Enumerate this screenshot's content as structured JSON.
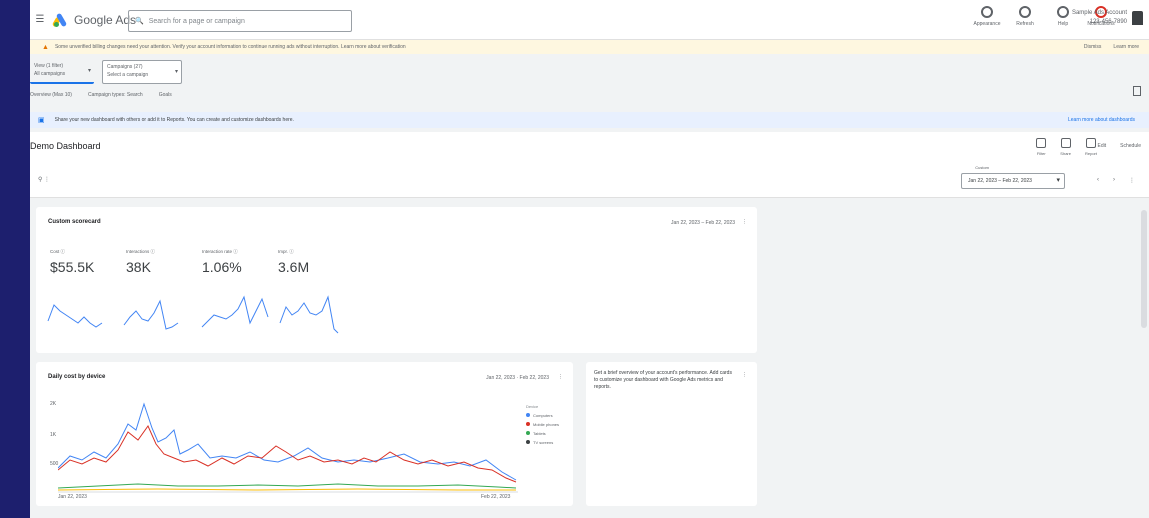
{
  "app": {
    "menu_icon": "menu-icon",
    "logo_text": "Google Ads",
    "logo_colors": [
      "#fbbc04",
      "#4285f4",
      "#34a853"
    ]
  },
  "search": {
    "placeholder": "Search for a page or campaign"
  },
  "top_actions": [
    {
      "name": "appearance-icon",
      "label": "Appearance"
    },
    {
      "name": "refresh-icon",
      "label": "Refresh"
    },
    {
      "name": "help-icon",
      "label": "Help"
    },
    {
      "name": "notifications-icon",
      "label": "Notifications"
    }
  ],
  "account": {
    "name": "Sample Ads Account",
    "id": "123-456-7890"
  },
  "alert": {
    "text": "Some unverified billing changes need your attention. Verify your account information to continue running ads without interruption. Learn more about verification",
    "actions": [
      "Dismiss",
      "Learn more"
    ]
  },
  "selectors": [
    {
      "caption": "View (1 filter)",
      "value": "All campaigns"
    },
    {
      "caption": "Campaigns (27)",
      "value": "Select a campaign"
    }
  ],
  "tabs": [
    "Overview (Max 10)",
    "Campaign types: Search",
    "Goals"
  ],
  "info": {
    "text": "Share your new dashboard with others or add it to Reports. You can create and customize dashboards here.",
    "link": "Learn more about dashboards"
  },
  "dashboard": {
    "title": "Demo Dashboard",
    "tools": [
      "Filter",
      "Share",
      "Report"
    ],
    "links": [
      "Edit",
      "Schedule"
    ],
    "date_label": "Custom",
    "date_range": "Jan 22, 2023 – Feb 22, 2023",
    "nav": [
      "‹",
      "›",
      "⋮"
    ]
  },
  "summary_card": {
    "title": "Custom scorecard",
    "menu": "Jan 22, 2023 – Feb 22, 2023",
    "metrics": [
      {
        "label": "Cost ⓘ",
        "value": "$55.5K"
      },
      {
        "label": "Interactions ⓘ",
        "value": "38K"
      },
      {
        "label": "Interaction rate ⓘ",
        "value": "1.06%"
      },
      {
        "label": "Impr. ⓘ",
        "value": "3.6M"
      }
    ],
    "spark_color": "#4285f4"
  },
  "daily_card": {
    "title": "Daily cost by device",
    "menu": "Jan 22, 2023 · Feb 22, 2023",
    "y_ticks": [
      "2K",
      "1K",
      "500"
    ],
    "x_ticks": [
      "Jan 22, 2023",
      "Feb 22, 2023"
    ],
    "legend_title": "Device",
    "legend": [
      {
        "name": "Computers",
        "color": "#4285f4"
      },
      {
        "name": "Mobile phones",
        "color": "#d93025"
      },
      {
        "name": "Tablets",
        "color": "#34a853"
      },
      {
        "name": "TV screens",
        "color": "#3c4043"
      }
    ]
  },
  "note_card": {
    "text": "Get a brief overview of your account's performance. Add cards to customize your dashboard with Google Ads metrics and reports."
  }
}
